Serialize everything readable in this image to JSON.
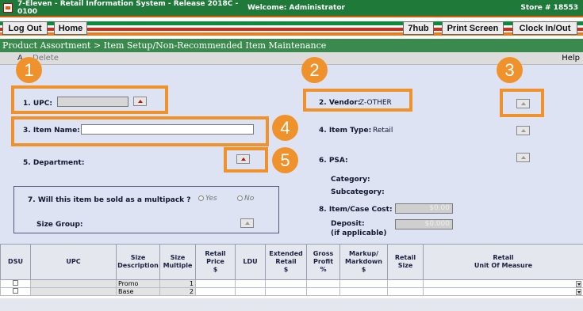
{
  "titlebar": {
    "system": "7-Eleven - Retail Information System - Release 2018C - 0100",
    "welcome": "Welcome: Administrator",
    "store": "Store # 18553"
  },
  "nav": {
    "logout": "Log Out",
    "home": "Home",
    "hub": "7hub",
    "print": "Print Screen",
    "clock": "Clock In/Out"
  },
  "breadcrumb": "Product Assortment > Item Setup/Non-Recommended Item Maintenance",
  "actions": {
    "add": "A",
    "delete": "Delete",
    "help": "Help"
  },
  "form": {
    "upc_label": "1. UPC:",
    "upc_value": "",
    "vendor_label": "2. Vendor:",
    "vendor_value": "Z-OTHER",
    "item_name_label": "3. Item Name:",
    "item_name_value": "",
    "item_type_label": "4. Item Type:",
    "item_type_value": "Retail",
    "department_label": "5. Department:",
    "psa_label": "6. PSA:",
    "category_label": "Category:",
    "subcategory_label": "Subcategory:",
    "multipack_label": "7. Will this item be sold as a multipack ?",
    "yes_label": "Yes",
    "no_label": "No",
    "size_group_label": "Size Group:",
    "case_cost_label": "8. Item/Case Cost:",
    "case_cost_value": "$0.00",
    "deposit_label": "Deposit:",
    "deposit_sub": "(if applicable)",
    "deposit_value": "$0.000"
  },
  "callouts": [
    "1",
    "2",
    "3",
    "4",
    "5"
  ],
  "grid": {
    "headers": [
      "DSU",
      "UPC",
      "Size\nDescription",
      "Size\nMultiple",
      "Retail\nPrice\n$",
      "LDU",
      "Extended\nRetail\n$",
      "Gross\nProfit\n%",
      "Markup/\nMarkdown\n$",
      "Retail\nSize",
      "Retail\nUnit Of Measure"
    ],
    "rows": [
      {
        "size_description": "Promo",
        "size_multiple": "1"
      },
      {
        "size_description": "Base",
        "size_multiple": "2"
      }
    ]
  },
  "colors": {
    "title_green": "#1f7a3a",
    "breadcrumb_green": "#3a8a4d",
    "form_bg": "#dde3f3",
    "callout_orange": "#f0922b"
  }
}
